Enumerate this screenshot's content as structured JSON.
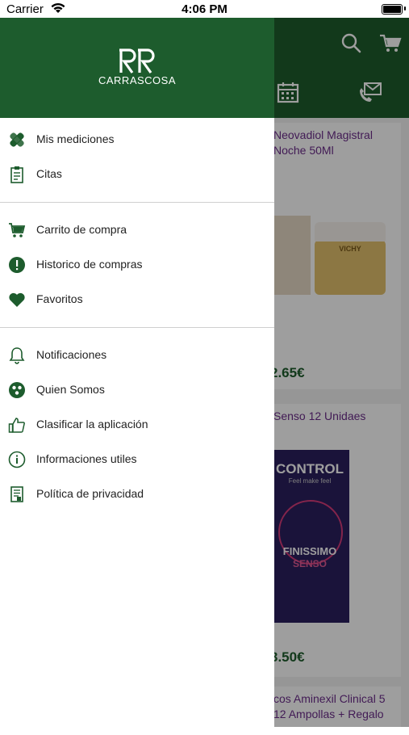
{
  "status_bar": {
    "carrier": "Carrier",
    "time": "4:06 PM"
  },
  "brand": {
    "name": "CARRASCOSA",
    "color": "#1d5c2d"
  },
  "menu": {
    "section1": [
      {
        "label": "Mis mediciones",
        "icon": "bandage-icon"
      },
      {
        "label": "Citas",
        "icon": "clipboard-icon"
      }
    ],
    "section2": [
      {
        "label": "Carrito de compra",
        "icon": "cart-icon"
      },
      {
        "label": "Historico de compras",
        "icon": "alert-circle-icon"
      },
      {
        "label": "Favoritos",
        "icon": "heart-icon"
      }
    ],
    "section3": [
      {
        "label": "Notificaciones",
        "icon": "bell-icon"
      },
      {
        "label": "Quien Somos",
        "icon": "group-icon"
      },
      {
        "label": "Clasificar la aplicación",
        "icon": "thumbs-up-icon"
      },
      {
        "label": "Informaciones utiles",
        "icon": "info-icon"
      },
      {
        "label": "Política de privacidad",
        "icon": "document-icon"
      }
    ]
  },
  "background": {
    "products": [
      {
        "title": "Neovadiol Magistral Noche 50Ml",
        "price": "2.65€",
        "brand_label": "VICHY"
      },
      {
        "title": "Senso 12 Unidaes",
        "price": "3.50€",
        "brand_label": "CONTROL",
        "tagline": "Feel make feel",
        "variant": "FINISSIMO",
        "subvariant": "SENSO"
      },
      {
        "title": "cos Aminexil Clinical 5 12 Ampollas + Regalo"
      }
    ]
  }
}
